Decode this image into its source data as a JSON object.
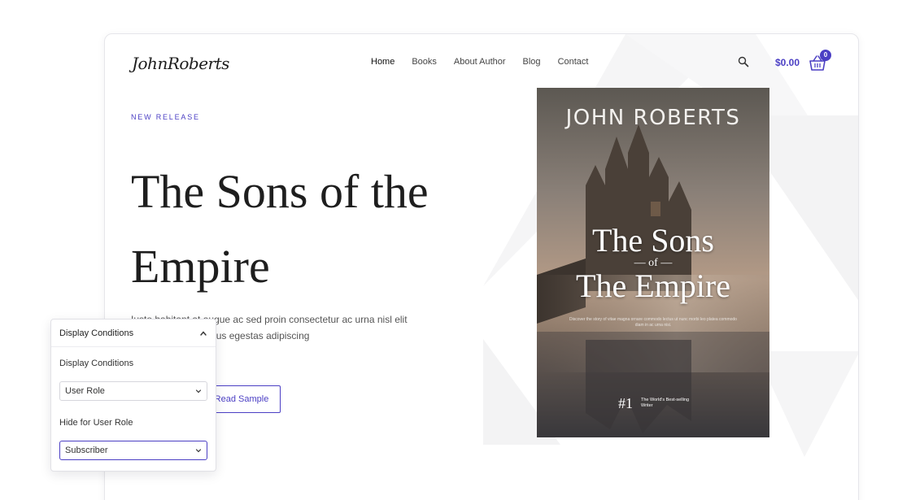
{
  "header": {
    "logo": "JohnRoberts",
    "nav": [
      "Home",
      "Books",
      "About Author",
      "Blog",
      "Contact"
    ],
    "cart_amount": "$0.00",
    "cart_count": "0"
  },
  "hero": {
    "eyebrow": "NEW RELEASE",
    "title": "The Sons of the Empire",
    "description": "Iusto habitant at augue ac sed proin consectetur ac urna nisl elit dolor sagittis nisi risus egestas adipiscing",
    "sample_button": "Read Sample"
  },
  "cover": {
    "author": "JOHN ROBERTS",
    "title_line1": "The Sons",
    "title_of": "— of —",
    "title_line2": "The Empire",
    "blurb": "Discover the story of vitae magna ornare commodo lectus ut nunc morbi leo platea commodo diam in ac urna nisi.",
    "rank": "#1",
    "rank_text": "The World's Best-selling Writer"
  },
  "panel": {
    "title": "Display Conditions",
    "conditions_label": "Display Conditions",
    "conditions_value": "User Role",
    "hide_label": "Hide for User Role",
    "hide_value": "Subscriber"
  },
  "colors": {
    "accent": "#4b3fc4",
    "text": "#1e1e1e"
  }
}
